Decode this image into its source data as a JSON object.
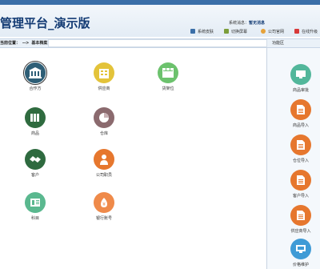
{
  "header": {
    "title": "管理平台_演示版",
    "system_message_label": "系统消息：",
    "system_message": "暂无消息"
  },
  "toolbar": {
    "items": [
      {
        "label": "系统皮肤"
      },
      {
        "label": "切换屏幕"
      },
      {
        "label": "公司官网"
      },
      {
        "label": "在线升级"
      }
    ]
  },
  "breadcrumb": {
    "label": "当前位置：",
    "sep": "-->",
    "current": "基本档案"
  },
  "quick_area_label": "功能区",
  "main_items": [
    {
      "label": "合作方",
      "icon": "bank-icon",
      "color": "#2e5e76"
    },
    {
      "label": "供应商",
      "icon": "building-icon",
      "color": "#e3c33a"
    },
    {
      "label": "货架位",
      "icon": "grid-icon",
      "color": "#6cc26d"
    },
    {
      "label": "商品",
      "icon": "books-icon",
      "color": "#2f6b3f"
    },
    {
      "label": "仓库",
      "icon": "pie-icon",
      "color": "#8b6a6e"
    },
    {
      "label": "客户",
      "icon": "handshake-icon",
      "color": "#2e6a3f"
    },
    {
      "label": "公司职员",
      "icon": "person-icon",
      "color": "#e6772e"
    },
    {
      "label": "科目",
      "icon": "ledger-icon",
      "color": "#5ab88f"
    },
    {
      "label": "银行账号",
      "icon": "coin-icon",
      "color": "#ef8a4a"
    }
  ],
  "side_items": [
    {
      "label": "商品审批",
      "icon": "monitor-icon",
      "color": "#52b79b"
    },
    {
      "label": "商品导入",
      "icon": "doc-icon",
      "color": "#e6772e"
    },
    {
      "label": "仓位导入",
      "icon": "doc-icon",
      "color": "#e6772e"
    },
    {
      "label": "客户导入",
      "icon": "doc-icon",
      "color": "#e6772e"
    },
    {
      "label": "供应商导入",
      "icon": "doc-icon",
      "color": "#e6772e"
    },
    {
      "label": "价格维护",
      "icon": "computer-icon",
      "color": "#3f9bd6"
    }
  ]
}
